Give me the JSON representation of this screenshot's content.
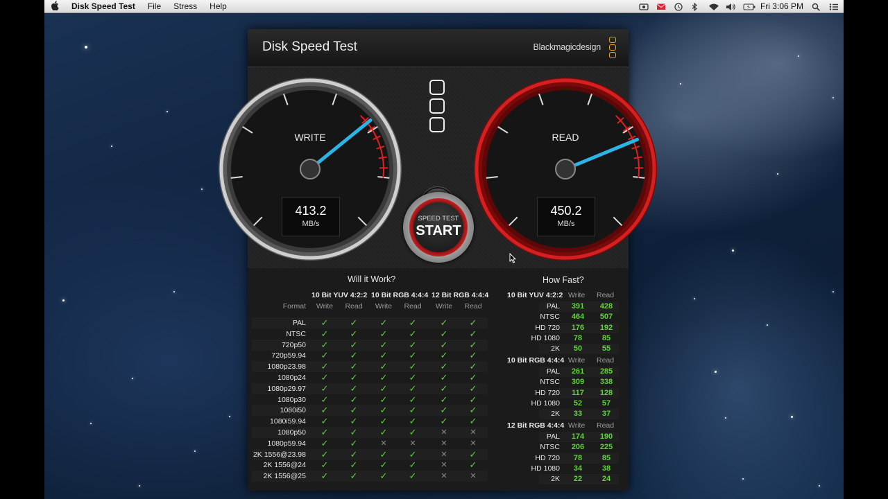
{
  "menubar": {
    "apple": "",
    "app_name": "Disk Speed Test",
    "items": [
      "File",
      "Stress",
      "Help"
    ],
    "clock": "Fri 3:06 PM"
  },
  "window": {
    "title": "Disk Speed Test",
    "brand": "Blackmagicdesign"
  },
  "gauges": {
    "write": {
      "label": "WRITE",
      "value": "413.2",
      "unit": "MB/s"
    },
    "read": {
      "label": "READ",
      "value": "450.2",
      "unit": "MB/s"
    }
  },
  "start_button": {
    "small": "SPEED TEST",
    "big": "START"
  },
  "will_it_work": {
    "title": "Will it Work?",
    "format_label": "Format",
    "groups": [
      "10 Bit YUV 4:2:2",
      "10 Bit RGB 4:4:4",
      "12 Bit RGB 4:4:4"
    ],
    "sub": [
      "Write",
      "Read"
    ],
    "rows": [
      {
        "format": "PAL",
        "marks": [
          1,
          1,
          1,
          1,
          1,
          1
        ]
      },
      {
        "format": "NTSC",
        "marks": [
          1,
          1,
          1,
          1,
          1,
          1
        ]
      },
      {
        "format": "720p50",
        "marks": [
          1,
          1,
          1,
          1,
          1,
          1
        ]
      },
      {
        "format": "720p59.94",
        "marks": [
          1,
          1,
          1,
          1,
          1,
          1
        ]
      },
      {
        "format": "1080p23.98",
        "marks": [
          1,
          1,
          1,
          1,
          1,
          1
        ]
      },
      {
        "format": "1080p24",
        "marks": [
          1,
          1,
          1,
          1,
          1,
          1
        ]
      },
      {
        "format": "1080p29.97",
        "marks": [
          1,
          1,
          1,
          1,
          1,
          1
        ]
      },
      {
        "format": "1080p30",
        "marks": [
          1,
          1,
          1,
          1,
          1,
          1
        ]
      },
      {
        "format": "1080i50",
        "marks": [
          1,
          1,
          1,
          1,
          1,
          1
        ]
      },
      {
        "format": "1080i59.94",
        "marks": [
          1,
          1,
          1,
          1,
          1,
          1
        ]
      },
      {
        "format": "1080p50",
        "marks": [
          1,
          1,
          1,
          1,
          0,
          0
        ]
      },
      {
        "format": "1080p59.94",
        "marks": [
          1,
          1,
          0,
          0,
          0,
          0
        ]
      },
      {
        "format": "2K 1556@23.98",
        "marks": [
          1,
          1,
          1,
          1,
          0,
          1
        ]
      },
      {
        "format": "2K 1556@24",
        "marks": [
          1,
          1,
          1,
          1,
          0,
          1
        ]
      },
      {
        "format": "2K 1556@25",
        "marks": [
          1,
          1,
          1,
          1,
          0,
          0
        ]
      }
    ]
  },
  "how_fast": {
    "title": "How Fast?",
    "write_label": "Write",
    "read_label": "Read",
    "groups": [
      {
        "name": "10 Bit YUV 4:2:2",
        "rows": [
          {
            "label": "PAL",
            "write": "391",
            "read": "428"
          },
          {
            "label": "NTSC",
            "write": "464",
            "read": "507"
          },
          {
            "label": "HD 720",
            "write": "176",
            "read": "192"
          },
          {
            "label": "HD 1080",
            "write": "78",
            "read": "85"
          },
          {
            "label": "2K",
            "write": "50",
            "read": "55"
          }
        ]
      },
      {
        "name": "10 Bit RGB 4:4:4",
        "rows": [
          {
            "label": "PAL",
            "write": "261",
            "read": "285"
          },
          {
            "label": "NTSC",
            "write": "309",
            "read": "338"
          },
          {
            "label": "HD 720",
            "write": "117",
            "read": "128"
          },
          {
            "label": "HD 1080",
            "write": "52",
            "read": "57"
          },
          {
            "label": "2K",
            "write": "33",
            "read": "37"
          }
        ]
      },
      {
        "name": "12 Bit RGB 4:4:4",
        "rows": [
          {
            "label": "PAL",
            "write": "174",
            "read": "190"
          },
          {
            "label": "NTSC",
            "write": "206",
            "read": "225"
          },
          {
            "label": "HD 720",
            "write": "78",
            "read": "85"
          },
          {
            "label": "HD 1080",
            "write": "34",
            "read": "38"
          },
          {
            "label": "2K",
            "write": "22",
            "read": "24"
          }
        ]
      }
    ]
  },
  "colors": {
    "check": "#5fd43a",
    "needle": "#2bb4e6",
    "red_ring": "#c41a1a",
    "brand_orange": "#f0a21e"
  }
}
